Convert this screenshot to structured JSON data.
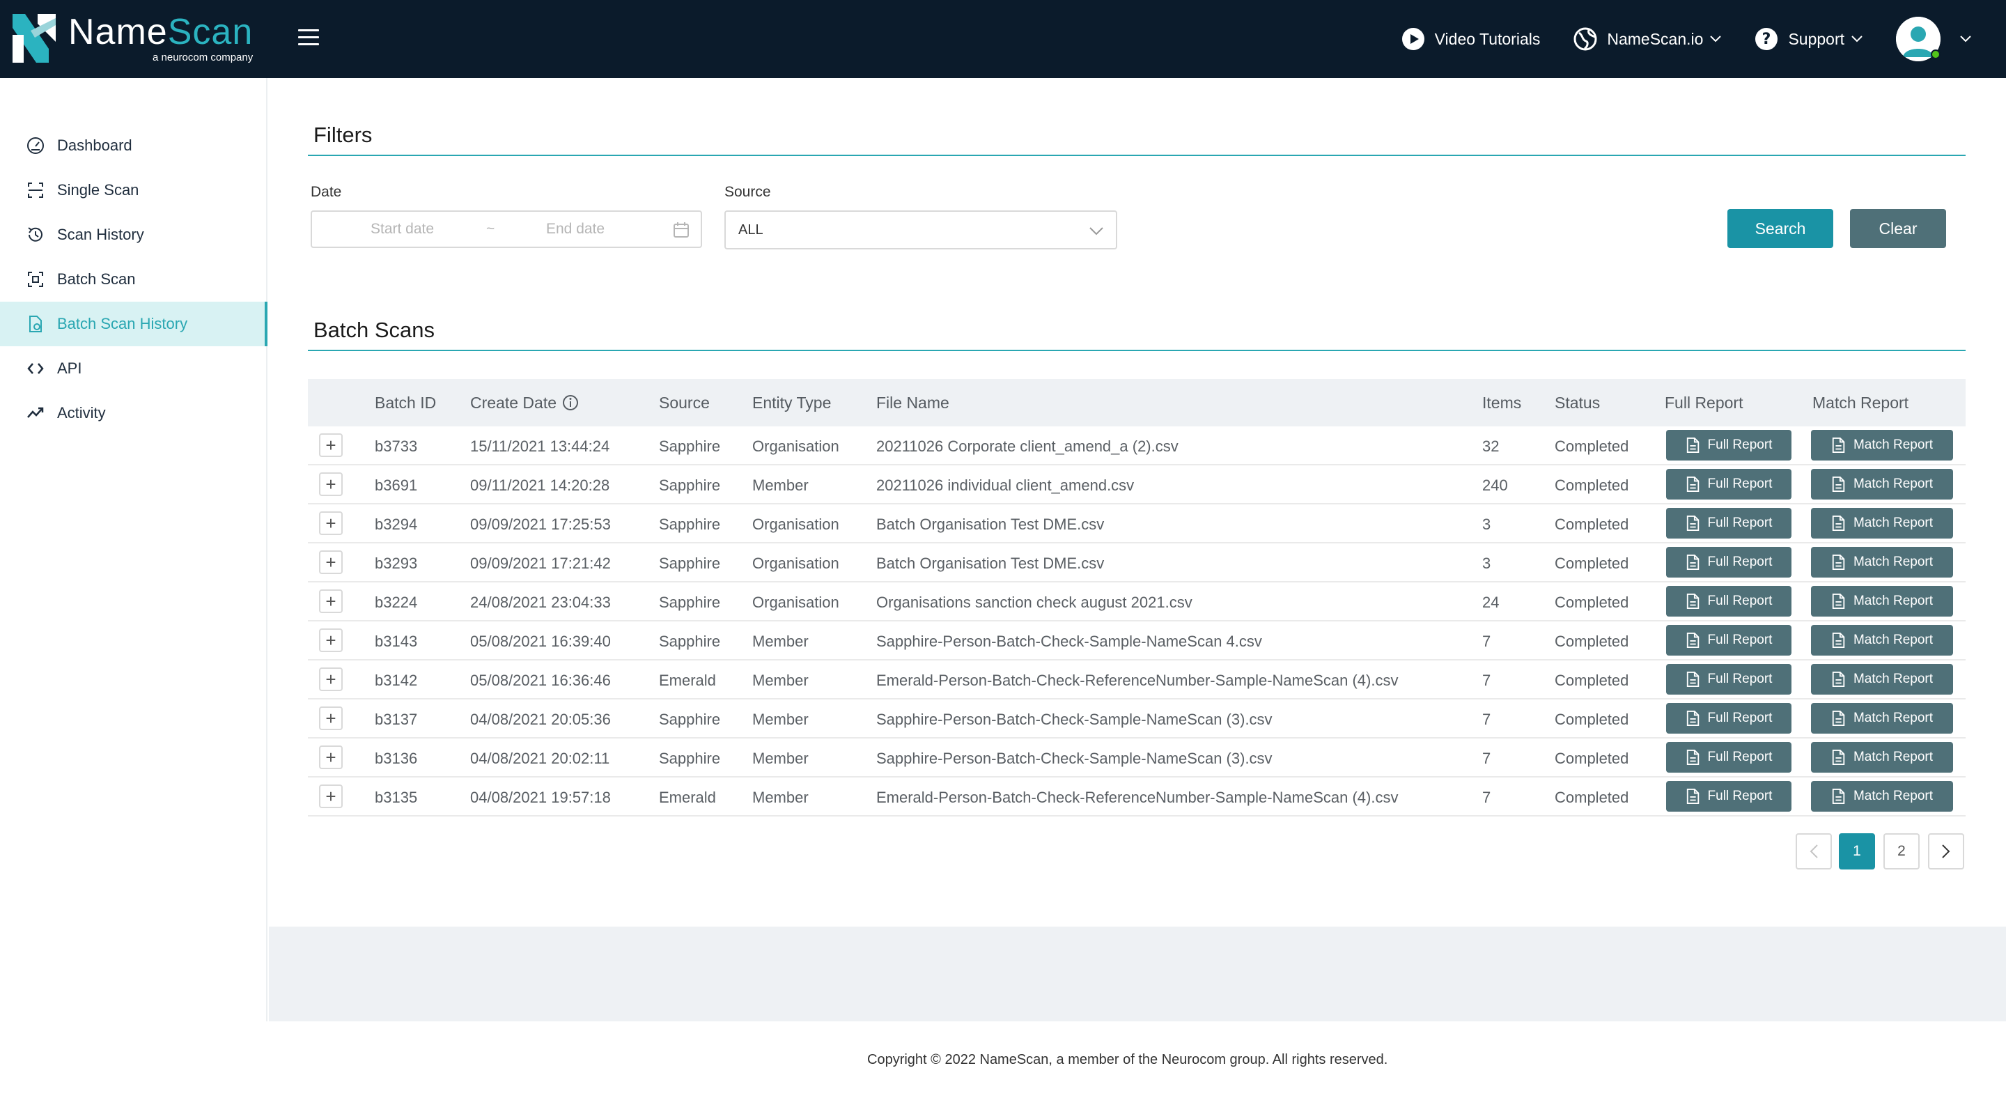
{
  "brand": {
    "name_part1": "Name",
    "name_part2": "Scan",
    "tagline": "a neurocom company"
  },
  "topnav": {
    "video_tutorials": "Video Tutorials",
    "namescan_io": "NameScan.io",
    "support": "Support"
  },
  "sidebar": {
    "items": [
      {
        "label": "Dashboard",
        "icon": "dashboard-icon"
      },
      {
        "label": "Single Scan",
        "icon": "scan-icon"
      },
      {
        "label": "Scan History",
        "icon": "history-icon"
      },
      {
        "label": "Batch Scan",
        "icon": "batch-icon"
      },
      {
        "label": "Batch Scan History",
        "icon": "file-history-icon",
        "active": true
      },
      {
        "label": "API",
        "icon": "code-icon"
      },
      {
        "label": "Activity",
        "icon": "activity-icon"
      }
    ]
  },
  "filters": {
    "title": "Filters",
    "date_label": "Date",
    "start_placeholder": "Start date",
    "separator": "~",
    "end_placeholder": "End date",
    "source_label": "Source",
    "source_value": "ALL",
    "search_label": "Search",
    "clear_label": "Clear"
  },
  "batch": {
    "title": "Batch Scans",
    "columns": [
      "Batch ID",
      "Create Date",
      "Source",
      "Entity Type",
      "File Name",
      "Items",
      "Status",
      "Full Report",
      "Match Report"
    ],
    "full_report_label": "Full Report",
    "match_report_label": "Match Report",
    "expand_symbol": "+",
    "rows": [
      [
        "b3733",
        "15/11/2021 13:44:24",
        "Sapphire",
        "Organisation",
        "20211026 Corporate client_amend_a (2).csv",
        "32",
        "Completed"
      ],
      [
        "b3691",
        "09/11/2021 14:20:28",
        "Sapphire",
        "Member",
        "20211026 individual client_amend.csv",
        "240",
        "Completed"
      ],
      [
        "b3294",
        "09/09/2021 17:25:53",
        "Sapphire",
        "Organisation",
        "Batch Organisation Test DME.csv",
        "3",
        "Completed"
      ],
      [
        "b3293",
        "09/09/2021 17:21:42",
        "Sapphire",
        "Organisation",
        "Batch Organisation Test DME.csv",
        "3",
        "Completed"
      ],
      [
        "b3224",
        "24/08/2021 23:04:33",
        "Sapphire",
        "Organisation",
        "Organisations sanction check august 2021.csv",
        "24",
        "Completed"
      ],
      [
        "b3143",
        "05/08/2021 16:39:40",
        "Sapphire",
        "Member",
        "Sapphire-Person-Batch-Check-Sample-NameScan 4.csv",
        "7",
        "Completed"
      ],
      [
        "b3142",
        "05/08/2021 16:36:46",
        "Emerald",
        "Member",
        "Emerald-Person-Batch-Check-ReferenceNumber-Sample-NameScan (4).csv",
        "7",
        "Completed"
      ],
      [
        "b3137",
        "04/08/2021 20:05:36",
        "Sapphire",
        "Member",
        "Sapphire-Person-Batch-Check-Sample-NameScan (3).csv",
        "7",
        "Completed"
      ],
      [
        "b3136",
        "04/08/2021 20:02:11",
        "Sapphire",
        "Member",
        "Sapphire-Person-Batch-Check-Sample-NameScan (3).csv",
        "7",
        "Completed"
      ],
      [
        "b3135",
        "04/08/2021 19:57:18",
        "Emerald",
        "Member",
        "Emerald-Person-Batch-Check-ReferenceNumber-Sample-NameScan (4).csv",
        "7",
        "Completed"
      ]
    ]
  },
  "pagination": {
    "prev": "<",
    "pages": [
      "1",
      "2"
    ],
    "current": "1",
    "next": ">"
  },
  "footer": {
    "copyright": "Copyright © 2022 NameScan, a member of the Neurocom group. All rights reserved."
  },
  "colors": {
    "navbar": "#0b1b2b",
    "accent": "#2aa7b2",
    "primary_button": "#1a93a5",
    "secondary_button": "#4f7078"
  }
}
